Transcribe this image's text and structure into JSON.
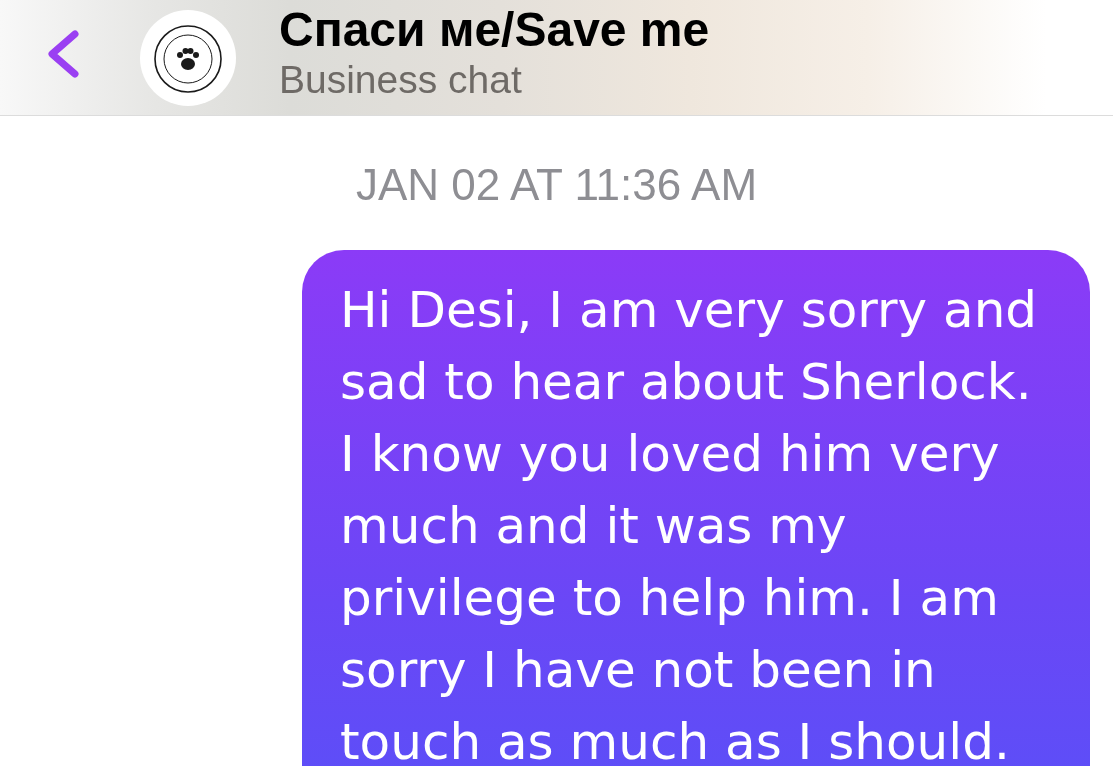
{
  "header": {
    "title": "Спаси ме/Save me",
    "subtitle": "Business chat"
  },
  "messages": [
    {
      "kind": "timestamp",
      "text": "JAN 02 AT 11:36 AM"
    },
    {
      "kind": "sent",
      "text": "Hi Desi, I am very sorry and sad to hear about Sherlock. I know you loved him very much and it was my privilege to help him. I am sorry I have not been in touch as much as I should."
    }
  ]
}
